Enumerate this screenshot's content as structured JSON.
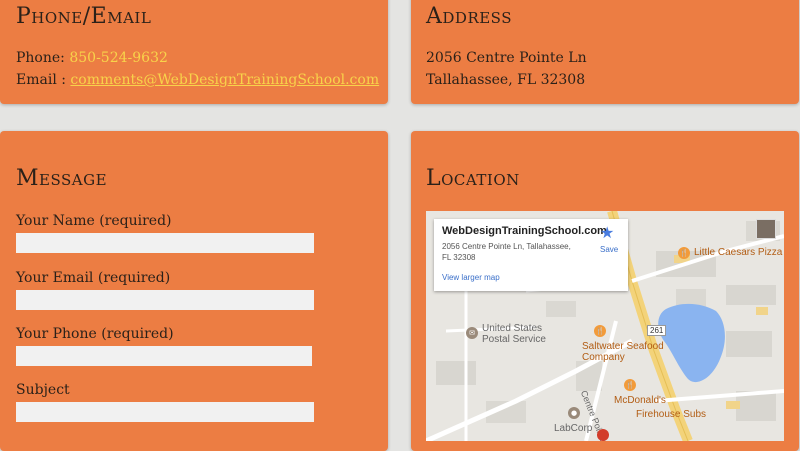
{
  "contact": {
    "title": "Phone/Email",
    "phone_label": "Phone: ",
    "phone_value": "850-524-9632",
    "email_label": "Email : ",
    "email_value": "comments@WebDesignTrainingSchool.com"
  },
  "address": {
    "title": "Address",
    "line1": "2056 Centre Pointe Ln",
    "line2": "Tallahassee, FL 32308"
  },
  "message": {
    "title": "Message",
    "fields": [
      {
        "label": "Your Name (required)",
        "value": ""
      },
      {
        "label": "Your Email (required)",
        "value": ""
      },
      {
        "label": "Your Phone (required)",
        "value": ""
      },
      {
        "label": "Subject",
        "value": ""
      }
    ]
  },
  "location": {
    "title": "Location",
    "map": {
      "info_title": "WebDesignTrainingSchool.com",
      "info_address": "2056 Centre Pointe Ln, Tallahassee, FL 32308",
      "info_link": "View larger map",
      "save_label": "Save",
      "labels": {
        "little_caesars": "Little Caesars Pizza",
        "usps": "United States Postal Service",
        "saltwater": "Saltwater Seafood Company",
        "mcdonalds": "McDonald's",
        "firehouse": "Firehouse Subs",
        "labcorp": "LabCorp",
        "street": "Centre Pointe",
        "route": "261"
      }
    }
  },
  "colors": {
    "card": "#ec7d43",
    "background": "#e4e4e2",
    "link": "#f8d34a",
    "text": "#2b2119"
  }
}
